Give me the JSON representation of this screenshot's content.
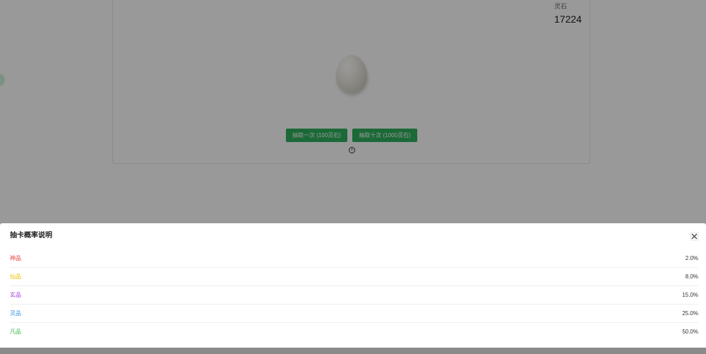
{
  "card": {
    "stone_label": "灵石",
    "stone_value": "17224",
    "draw_one_label": "抽取一次 (100灵石)",
    "draw_ten_label": "抽取十次 (1000灵石)",
    "info_glyph": "i",
    "egg_icon": "egg-icon"
  },
  "modal": {
    "title": "抽卡概率说明",
    "close_icon": "close-icon",
    "rows": [
      {
        "label": "神品",
        "value": "2.0%",
        "color": "#e8413c"
      },
      {
        "label": "仙品",
        "value": "8.0%",
        "color": "#e6c400"
      },
      {
        "label": "玄品",
        "value": "15.0%",
        "color": "#a145e0"
      },
      {
        "label": "灵品",
        "value": "25.0%",
        "color": "#3a96e0"
      },
      {
        "label": "凡品",
        "value": "50.0%",
        "color": "#3dbb49"
      }
    ]
  },
  "colors": {
    "button": "#2eb05c",
    "overlay": "rgba(0,0,0,0.4)"
  }
}
